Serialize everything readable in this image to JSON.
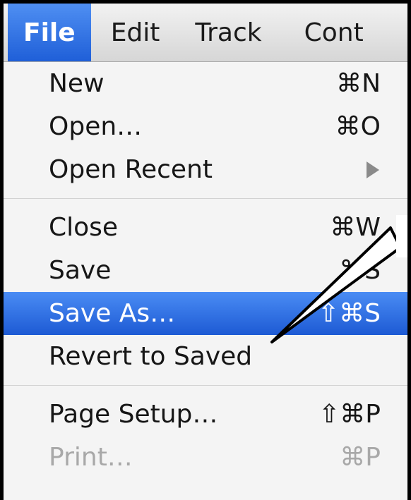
{
  "menubar": {
    "items": [
      {
        "label": "File",
        "active": true
      },
      {
        "label": "Edit"
      },
      {
        "label": "Track"
      },
      {
        "label": "Cont"
      }
    ]
  },
  "file_menu": {
    "items": [
      {
        "label": "New",
        "shortcut": "⌘N"
      },
      {
        "label": "Open…",
        "shortcut": "⌘O"
      },
      {
        "label": "Open Recent",
        "shortcut": "",
        "submenu": true
      },
      {
        "label": "Close",
        "shortcut": "⌘W"
      },
      {
        "label": "Save",
        "shortcut": "⌘S"
      },
      {
        "label": "Save As…",
        "shortcut": "⇧⌘S",
        "highlighted": true
      },
      {
        "label": "Revert to Saved",
        "shortcut": ""
      },
      {
        "label": "Page Setup…",
        "shortcut": "⇧⌘P"
      },
      {
        "label": "Print…",
        "shortcut": "⌘P",
        "disabled": true
      }
    ]
  },
  "colors": {
    "highlight": "#1f5fd8",
    "menu_background": "#f4f4f4",
    "frame_border": "#000000"
  },
  "icons": {
    "submenu": "triangle-right-icon",
    "callout": "callout-pointer"
  }
}
